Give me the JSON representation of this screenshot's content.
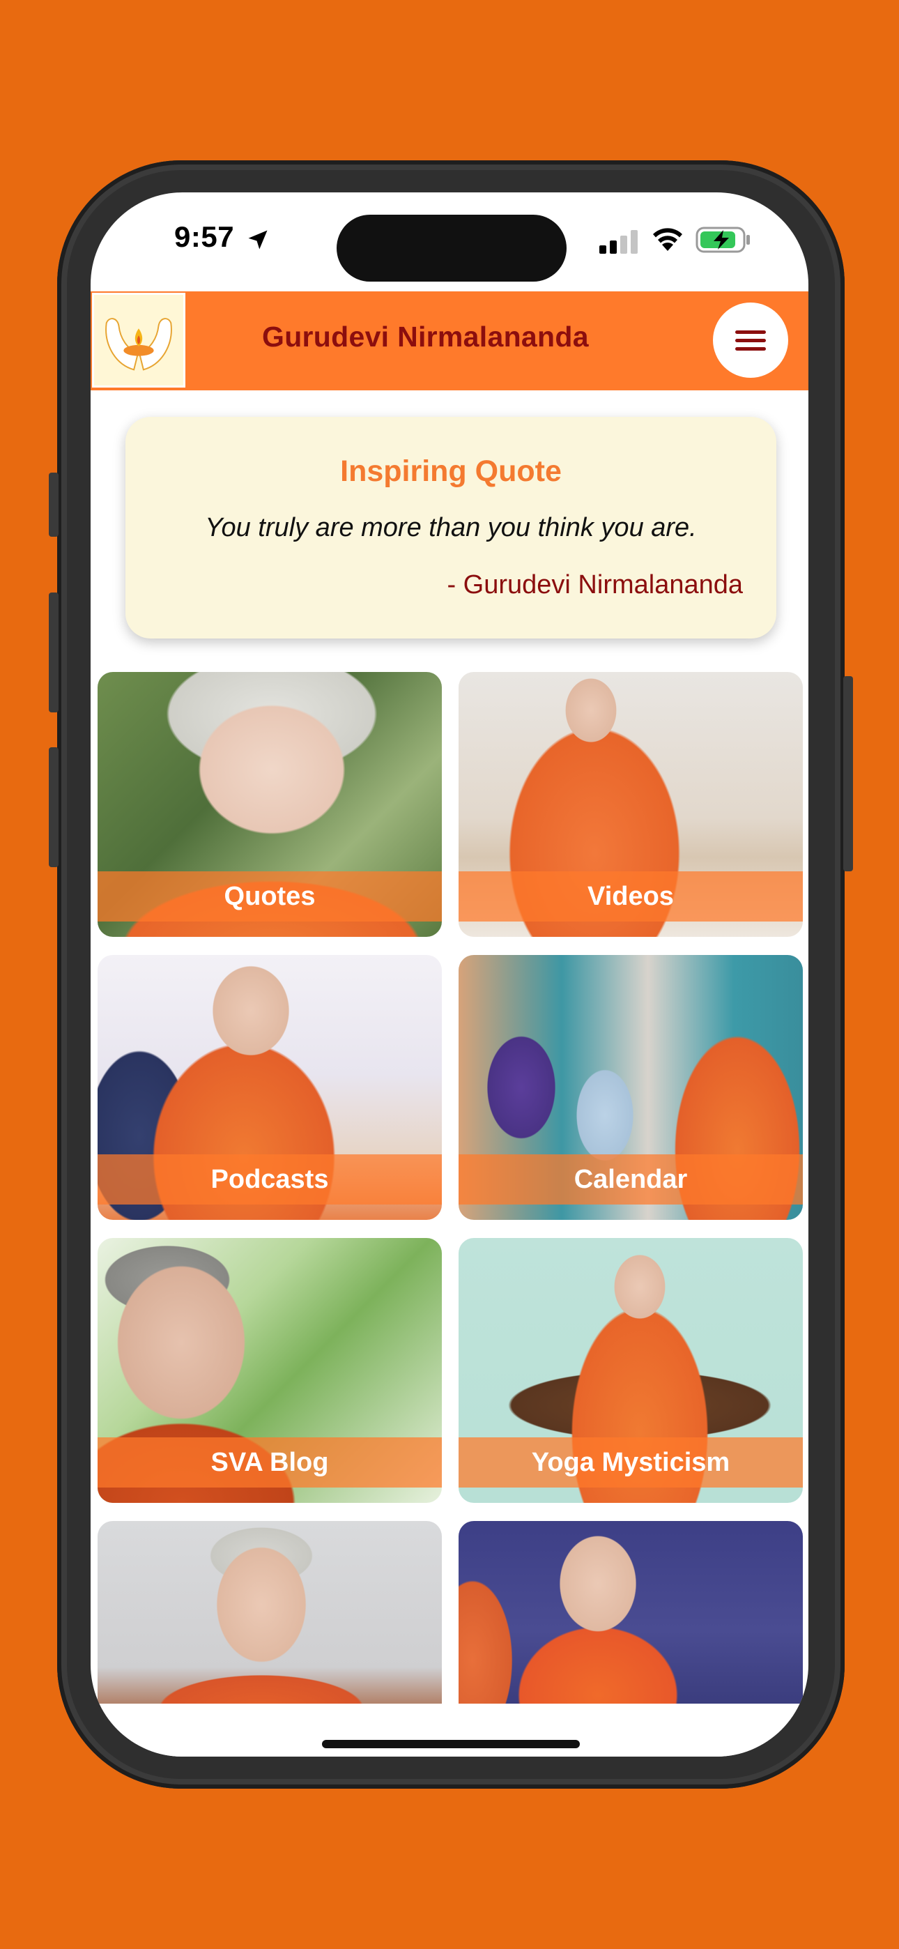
{
  "status_bar": {
    "time": "9:57"
  },
  "header": {
    "title": "Gurudevi Nirmalananda"
  },
  "quote": {
    "title": "Inspiring Quote",
    "text": "You truly are more than you think you are.",
    "author": "- Gurudevi Nirmalananda"
  },
  "tiles": [
    {
      "label": "Quotes"
    },
    {
      "label": "Videos"
    },
    {
      "label": "Podcasts"
    },
    {
      "label": "Calendar"
    },
    {
      "label": "SVA Blog"
    },
    {
      "label": "Yoga Mysticism"
    },
    {
      "label": ""
    },
    {
      "label": ""
    }
  ],
  "colors": {
    "background": "#E86A10",
    "header": "#FF7A2B",
    "title_text": "#8B0E0E",
    "quote_title": "#F47A30",
    "quote_card": "#FBF6DC"
  }
}
